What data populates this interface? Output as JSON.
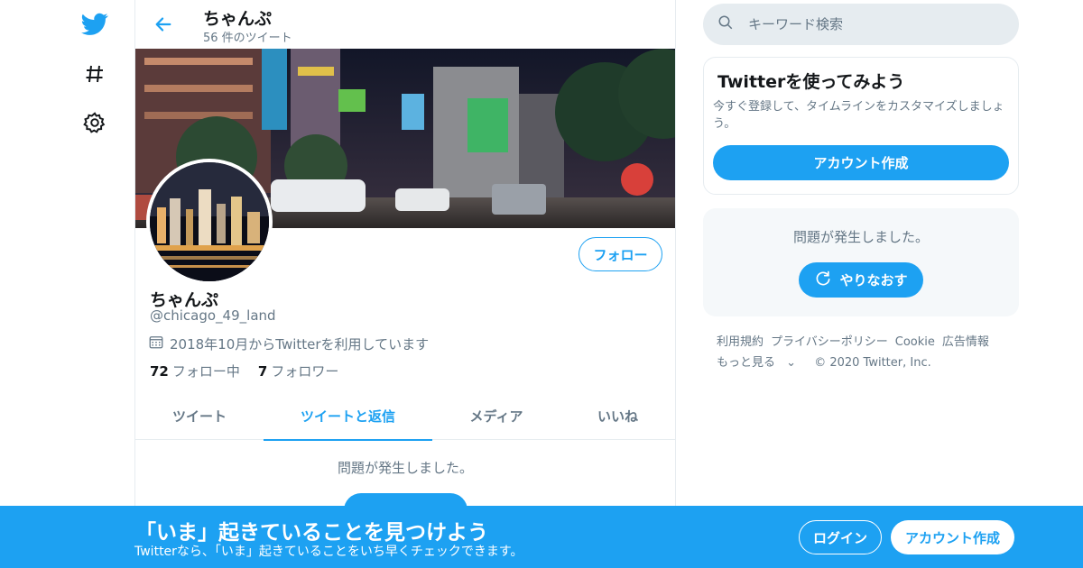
{
  "colors": {
    "accent": "#1da1f2",
    "text": "#14171a",
    "muted": "#657786",
    "border": "#e6ecf0",
    "panel": "#f5f8fa"
  },
  "nav": {
    "icons": [
      "twitter-bird-icon",
      "hashtag-icon",
      "gear-icon"
    ]
  },
  "header": {
    "title": "ちゃんぷ",
    "tweet_count": "56 件のツイート"
  },
  "profile": {
    "name": "ちゃんぷ",
    "handle": "@chicago_49_land",
    "joined": "2018年10月からTwitterを利用しています",
    "following_count": "72",
    "following_label": "フォロー中",
    "followers_count": "7",
    "followers_label": "フォロワー",
    "follow_button": "フォロー"
  },
  "tabs": [
    {
      "label": "ツイート"
    },
    {
      "label": "ツイートと返信"
    },
    {
      "label": "メディア"
    },
    {
      "label": "いいね"
    }
  ],
  "main": {
    "error_text": "問題が発生しました。"
  },
  "search": {
    "placeholder": "キーワード検索"
  },
  "signup_card": {
    "title": "Twitterを使ってみよう",
    "description": "今すぐ登録して、タイムラインをカスタマイズしましょう。",
    "button": "アカウント作成"
  },
  "error_card": {
    "text": "問題が発生しました。",
    "retry": "やりなおす"
  },
  "footer": {
    "terms": "利用規約",
    "privacy": "プライバシーポリシー",
    "cookie": "Cookie",
    "ads": "広告情報",
    "more": "もっと見る",
    "copyright": "© 2020 Twitter, Inc."
  },
  "bottom_bar": {
    "title": "「いま」起きていることを見つけよう",
    "subtitle": "Twitterなら、「いま」起きていることをいち早くチェックできます。",
    "login": "ログイン",
    "signup": "アカウント作成"
  }
}
